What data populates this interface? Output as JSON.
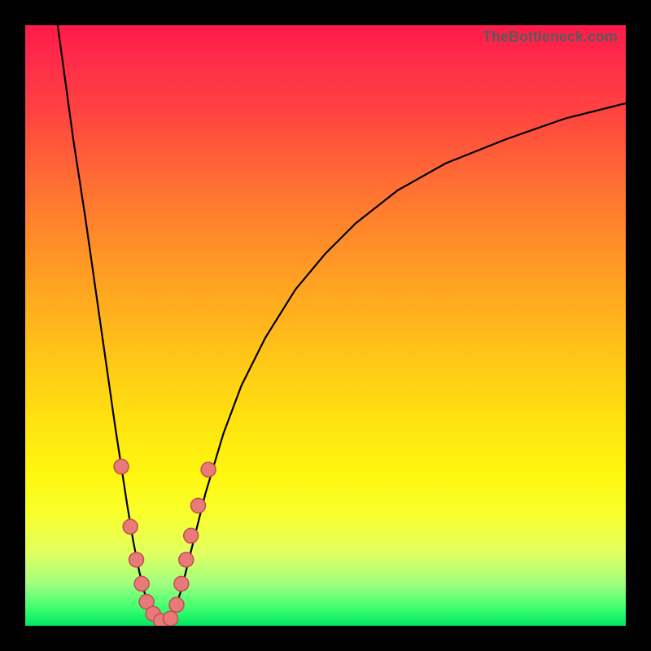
{
  "watermark": "TheBottleneck.com",
  "chart_data": {
    "type": "line",
    "title": "",
    "xlabel": "",
    "ylabel": "",
    "xlim": [
      0,
      100
    ],
    "ylim": [
      0,
      100
    ],
    "curve_left": {
      "x": [
        5.4,
        6.5,
        8,
        10,
        12,
        14,
        15,
        16,
        17,
        18,
        19,
        20,
        21,
        22,
        23
      ],
      "y": [
        100,
        92,
        81,
        68,
        54,
        40,
        33,
        26.5,
        20,
        14,
        9,
        5,
        2,
        0.8,
        0
      ]
    },
    "curve_right": {
      "x": [
        23,
        24,
        25,
        26,
        27,
        28,
        30,
        33,
        36,
        40,
        45,
        50,
        55,
        62,
        70,
        80,
        90,
        100
      ],
      "y": [
        0,
        1,
        3,
        6,
        10,
        14,
        22,
        32,
        40,
        48,
        56,
        62,
        67,
        72.5,
        77,
        81,
        84.5,
        87
      ]
    },
    "markers": [
      {
        "x": 16.0,
        "y": 26.5
      },
      {
        "x": 17.5,
        "y": 16.5
      },
      {
        "x": 18.5,
        "y": 11
      },
      {
        "x": 19.4,
        "y": 7
      },
      {
        "x": 20.2,
        "y": 4
      },
      {
        "x": 21.3,
        "y": 2
      },
      {
        "x": 22.6,
        "y": 0.8
      },
      {
        "x": 24.2,
        "y": 1.2
      },
      {
        "x": 25.2,
        "y": 3.5
      },
      {
        "x": 26.0,
        "y": 7
      },
      {
        "x": 26.8,
        "y": 11
      },
      {
        "x": 27.6,
        "y": 15
      },
      {
        "x": 28.8,
        "y": 20
      },
      {
        "x": 30.5,
        "y": 26
      }
    ],
    "marker_radius_px": 9,
    "gradient_description": "vertical red-to-green heatmap background"
  }
}
